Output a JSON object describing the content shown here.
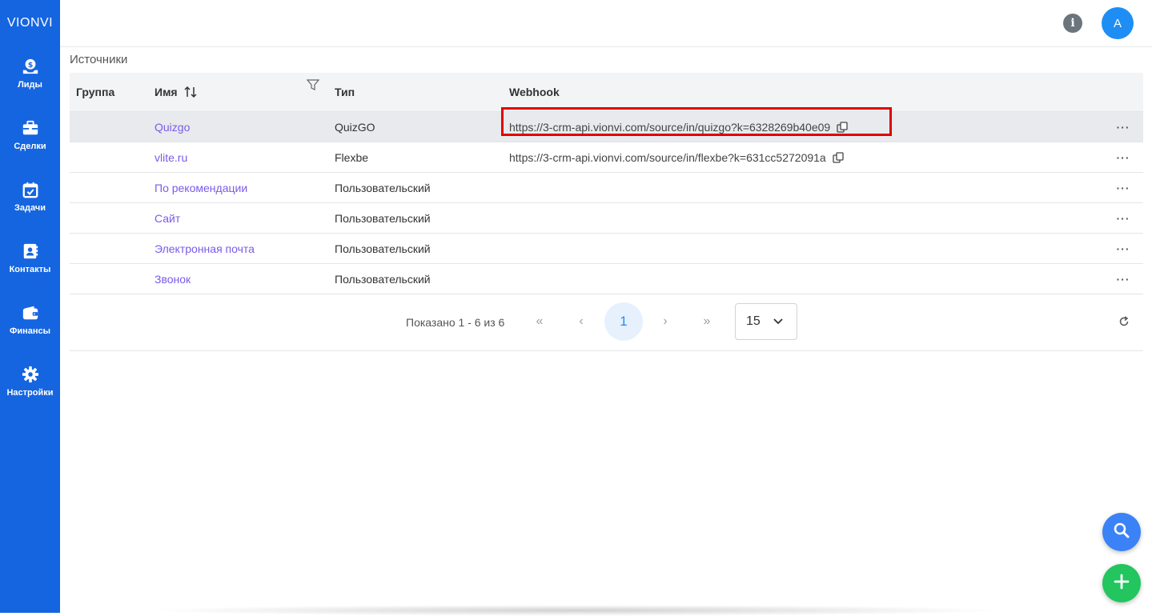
{
  "app": {
    "brand": "VIONVI"
  },
  "sidebar": {
    "items": [
      {
        "label": "Лиды",
        "icon": "leads-icon"
      },
      {
        "label": "Сделки",
        "icon": "briefcase-icon"
      },
      {
        "label": "Задачи",
        "icon": "calendar-check-icon"
      },
      {
        "label": "Контакты",
        "icon": "contact-book-icon"
      },
      {
        "label": "Финансы",
        "icon": "wallet-icon"
      },
      {
        "label": "Настройки",
        "icon": "gear-icon"
      }
    ]
  },
  "header": {
    "info_icon": "i",
    "avatar_letter": "A"
  },
  "page": {
    "title": "Источники"
  },
  "table": {
    "columns": {
      "group": "Группа",
      "name": "Имя",
      "type": "Тип",
      "webhook": "Webhook"
    },
    "rows": [
      {
        "group": "",
        "name": "Quizgo",
        "type": "QuizGO",
        "webhook": "https://3-crm-api.vionvi.com/source/in/quizgo?k=6328269b40e09",
        "actions": "···"
      },
      {
        "group": "",
        "name": "vlite.ru",
        "type": "Flexbe",
        "webhook": "https://3-crm-api.vionvi.com/source/in/flexbe?k=631cc5272091a",
        "actions": "···"
      },
      {
        "group": "",
        "name": "По рекомендации",
        "type": "Пользовательский",
        "webhook": "",
        "actions": "···"
      },
      {
        "group": "",
        "name": "Сайт",
        "type": "Пользовательский",
        "webhook": "",
        "actions": "···"
      },
      {
        "group": "",
        "name": "Электронная почта",
        "type": "Пользовательский",
        "webhook": "",
        "actions": "···"
      },
      {
        "group": "",
        "name": "Звонок",
        "type": "Пользовательский",
        "webhook": "",
        "actions": "···"
      }
    ]
  },
  "pagination": {
    "info": "Показано 1 - 6 из 6",
    "first": "«",
    "prev": "‹",
    "current": "1",
    "next": "›",
    "last": "»",
    "per_page": "15"
  },
  "colors": {
    "sidebar": "#1565e0",
    "link": "#7b5be8",
    "highlight_border": "#e00000",
    "fab_search": "#3b82f6",
    "fab_add": "#22c55e"
  }
}
